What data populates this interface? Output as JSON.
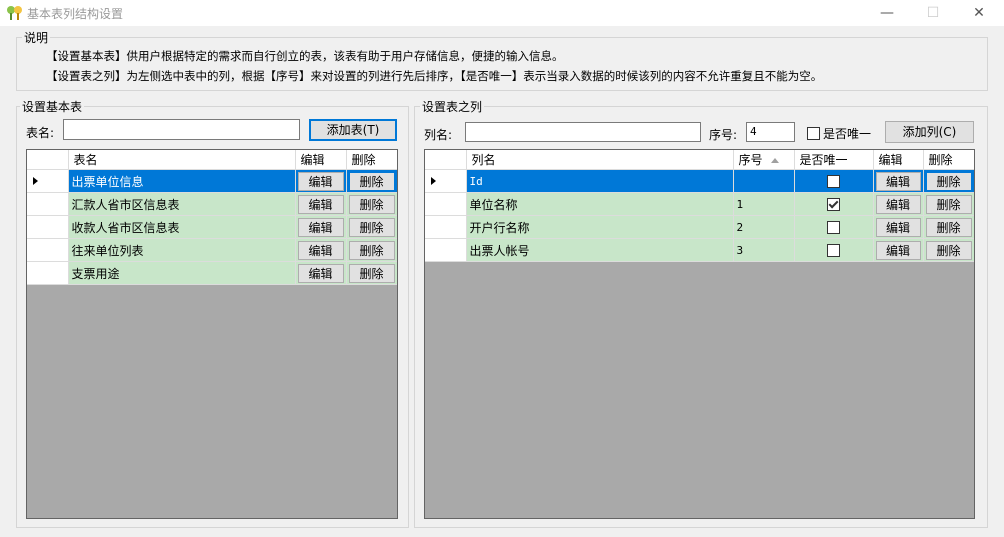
{
  "window": {
    "title": "基本表列结构设置",
    "minimize": "—",
    "maximize": "☐",
    "close": "✕"
  },
  "description": {
    "label": "说明",
    "line1": "【设置基本表】供用户根据特定的需求而自行创立的表，该表有助于用户存储信息，便捷的输入信息。",
    "line2": "【设置表之列】为左侧选中表中的列，根据【序号】来对设置的列进行先后排序，【是否唯一】表示当录入数据的时候该列的内容不允许重复且不能为空。"
  },
  "left_panel": {
    "label": "设置基本表",
    "table_name_label": "表名:",
    "table_name_value": "",
    "add_table_button": "添加表(T)",
    "grid": {
      "headers": [
        "表名",
        "编辑",
        "删除"
      ],
      "rows": [
        {
          "name": "出票单位信息",
          "edit": "编辑",
          "delete": "删除"
        },
        {
          "name": "汇款人省市区信息表",
          "edit": "编辑",
          "delete": "删除"
        },
        {
          "name": "收款人省市区信息表",
          "edit": "编辑",
          "delete": "删除"
        },
        {
          "name": "往来单位列表",
          "edit": "编辑",
          "delete": "删除"
        },
        {
          "name": "支票用途",
          "edit": "编辑",
          "delete": "删除"
        }
      ]
    }
  },
  "right_panel": {
    "label": "设置表之列",
    "column_name_label": "列名:",
    "column_name_value": "",
    "seq_label": "序号:",
    "seq_value": "4",
    "unique_label": "是否唯一",
    "unique_checked": false,
    "add_column_button": "添加列(C)",
    "grid": {
      "headers": [
        "列名",
        "序号",
        "是否唯一",
        "编辑",
        "删除"
      ],
      "rows": [
        {
          "name": "Id",
          "seq": "",
          "unique": false,
          "edit": "编辑",
          "delete": "删除"
        },
        {
          "name": "单位名称",
          "seq": "1",
          "unique": true,
          "edit": "编辑",
          "delete": "删除"
        },
        {
          "name": "开户行名称",
          "seq": "2",
          "unique": false,
          "edit": "编辑",
          "delete": "删除"
        },
        {
          "name": "出票人帐号",
          "seq": "3",
          "unique": false,
          "edit": "编辑",
          "delete": "删除"
        }
      ]
    }
  },
  "colors": {
    "row_background": "#c8e6c9",
    "selected_row": "#0078d7",
    "grid_empty_area": "#a9a9a9"
  }
}
